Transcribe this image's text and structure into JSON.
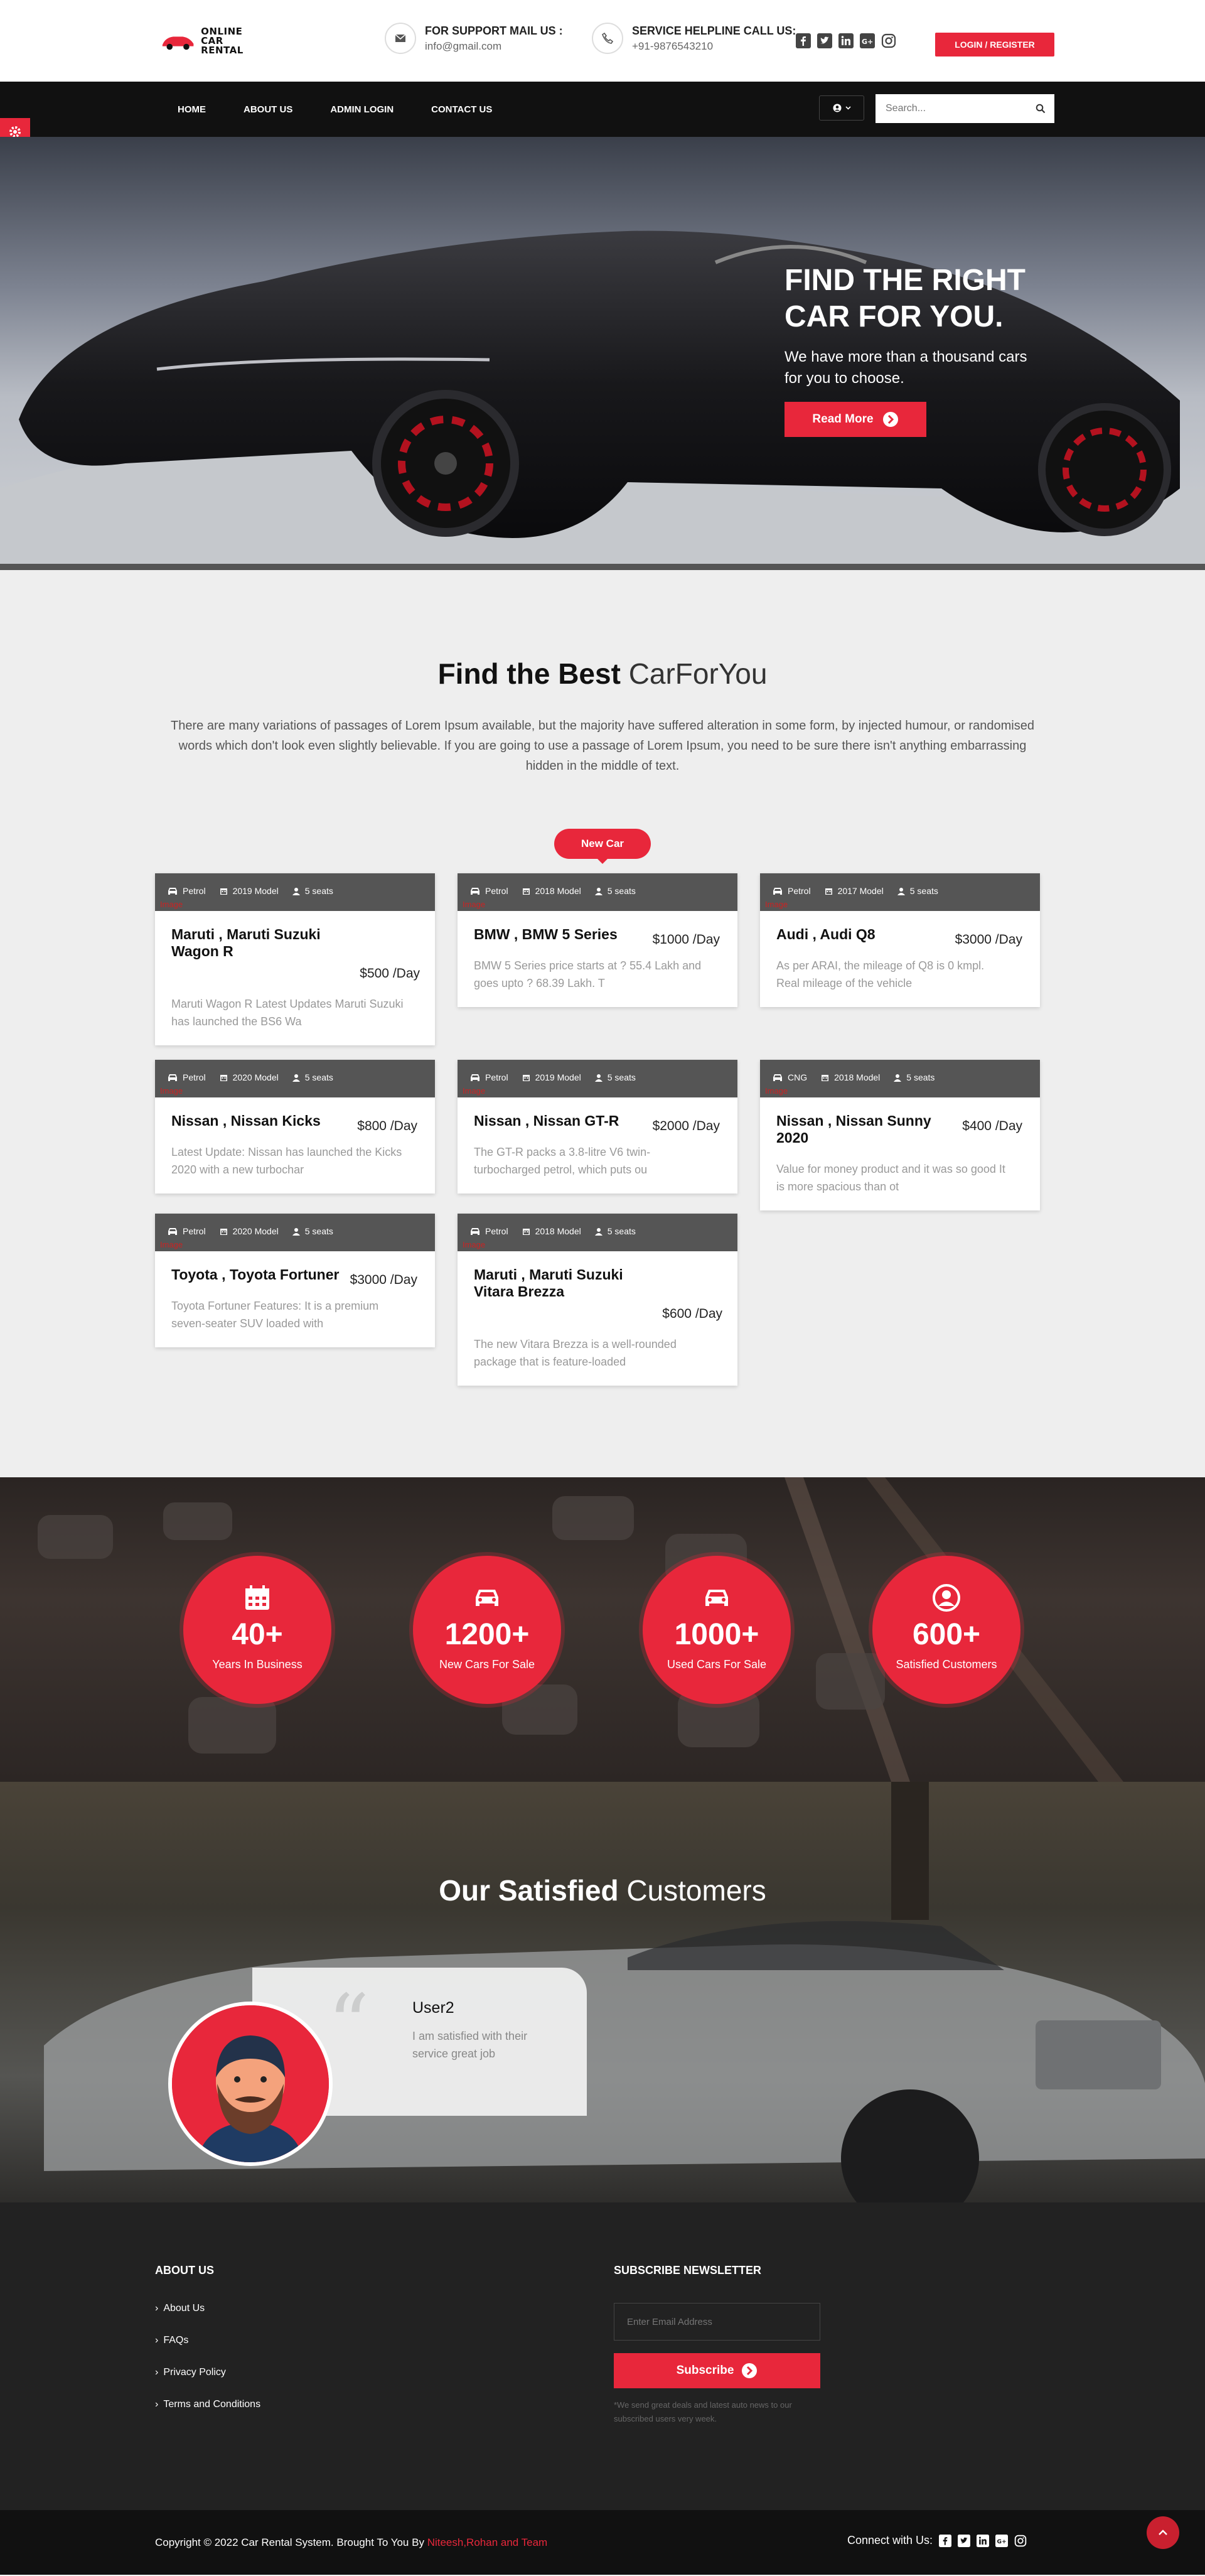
{
  "header": {
    "logo_text": "ONLINE CAR RENTAL",
    "support_title": "FOR SUPPORT MAIL US :",
    "support_value": "info@gmail.com",
    "helpline_title": "SERVICE HELPLINE CALL US:",
    "helpline_value": "+91-9876543210",
    "socials": [
      "facebook-icon",
      "twitter-icon",
      "linkedin-icon",
      "google-plus-icon",
      "instagram-icon"
    ],
    "login_label": "LOGIN / REGISTER"
  },
  "nav": {
    "items": [
      "HOME",
      "ABOUT US",
      "ADMIN LOGIN",
      "CONTACT US"
    ],
    "search_placeholder": "Search..."
  },
  "hero": {
    "title": "FIND THE RIGHT CAR FOR YOU.",
    "subtitle": "We have more than a thousand cars for you to choose.",
    "button": "Read More"
  },
  "listing": {
    "title_bold": "Find the Best",
    "title_rest": "CarForYou",
    "description": "There are many variations of passages of Lorem Ipsum available, but the majority have suffered alteration in some form, by injected humour, or randomised words which don't look even slightly believable. If you are going to use a passage of Lorem Ipsum, you need to be sure there isn't anything embarrassing hidden in the middle of text.",
    "tab": "New Car",
    "img_alt": "Image",
    "cars": [
      {
        "fuel": "Petrol",
        "model": "2019 Model",
        "seats": "5 seats",
        "name": "Maruti , Maruti Suzuki Wagon R",
        "price": "$500 /Day",
        "desc": "Maruti Wagon R Latest Updates Maruti Suzuki has launched the BS6 Wa"
      },
      {
        "fuel": "Petrol",
        "model": "2018 Model",
        "seats": "5 seats",
        "name": "BMW , BMW 5 Series",
        "price": "$1000 /Day",
        "desc": "BMW 5 Series price starts at ? 55.4 Lakh and goes upto ? 68.39 Lakh. T"
      },
      {
        "fuel": "Petrol",
        "model": "2017 Model",
        "seats": "5 seats",
        "name": "Audi , Audi Q8",
        "price": "$3000 /Day",
        "desc": "As per ARAI, the mileage of Q8 is 0 kmpl. Real mileage of the vehicle"
      },
      {
        "fuel": "Petrol",
        "model": "2020 Model",
        "seats": "5 seats",
        "name": "Nissan , Nissan Kicks",
        "price": "$800 /Day",
        "desc": "Latest Update: Nissan has launched the Kicks 2020 with a new turbochar"
      },
      {
        "fuel": "Petrol",
        "model": "2019 Model",
        "seats": "5 seats",
        "name": "Nissan , Nissan GT-R",
        "price": "$2000 /Day",
        "desc": "The GT-R packs a 3.8-litre V6 twin-turbocharged petrol, which puts ou"
      },
      {
        "fuel": "CNG",
        "model": "2018 Model",
        "seats": "5 seats",
        "name": "Nissan , Nissan Sunny 2020",
        "price": "$400 /Day",
        "desc": "Value for money product and it was so good It is more spacious than ot"
      },
      {
        "fuel": "Petrol",
        "model": "2020 Model",
        "seats": "5 seats",
        "name": "Toyota , Toyota Fortuner",
        "price": "$3000 /Day",
        "desc": "Toyota Fortuner Features: It is a premium seven-seater SUV loaded with"
      },
      {
        "fuel": "Petrol",
        "model": "2018 Model",
        "seats": "5 seats",
        "name": "Maruti , Maruti Suzuki Vitara Brezza",
        "price": "$600 /Day",
        "desc": "The new Vitara Brezza is a well-rounded package that is feature-loaded"
      }
    ]
  },
  "stats": [
    {
      "icon": "calendar-icon",
      "number": "40+",
      "label": "Years In Business"
    },
    {
      "icon": "car-icon",
      "number": "1200+",
      "label": "New Cars For Sale"
    },
    {
      "icon": "car-icon",
      "number": "1000+",
      "label": "Used Cars For Sale"
    },
    {
      "icon": "user-circle-icon",
      "number": "600+",
      "label": "Satisfied Customers"
    }
  ],
  "customers": {
    "title_bold": "Our Satisfied",
    "title_rest": "Customers",
    "testimonial": {
      "name": "User2",
      "text": "I am satisfied with their service great job"
    }
  },
  "footer": {
    "about_heading": "ABOUT US",
    "links": [
      "About Us",
      "FAQs",
      "Privacy Policy",
      "Terms and Conditions"
    ],
    "newsletter_heading": "SUBSCRIBE NEWSLETTER",
    "email_placeholder": "Enter Email Address",
    "subscribe_label": "Subscribe",
    "note": "*We send great deals and latest auto news to our subscribed users very week.",
    "copyright": "Copyright © 2022 Car Rental System. Brought To You By ",
    "copyright_highlight": "Niteesh,Rohan and Team",
    "connect_label": "Connect with Us:"
  },
  "colors": {
    "accent": "#e8273b",
    "dark": "#111111",
    "footer": "#222222"
  }
}
